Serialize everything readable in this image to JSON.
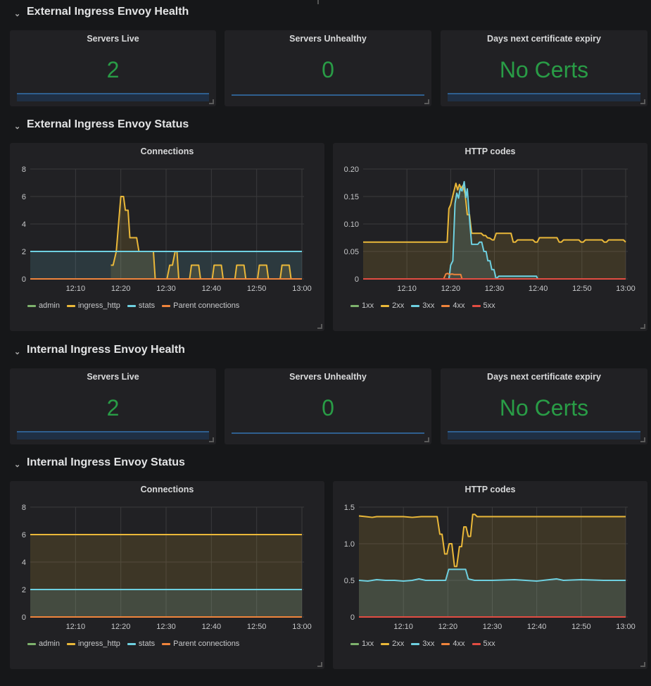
{
  "rows": [
    {
      "title": "External Ingress Envoy Health"
    },
    {
      "title": "External Ingress Envoy Status"
    },
    {
      "title": "Internal Ingress Envoy Health"
    },
    {
      "title": "Internal Ingress Envoy Status"
    }
  ],
  "stat_panels": {
    "external": [
      {
        "title": "Servers Live",
        "value": "2"
      },
      {
        "title": "Servers Unhealthy",
        "value": "0"
      },
      {
        "title": "Days next certificate expiry",
        "value": "No Certs"
      }
    ],
    "internal": [
      {
        "title": "Servers Live",
        "value": "2"
      },
      {
        "title": "Servers Unhealthy",
        "value": "0"
      },
      {
        "title": "Days next certificate expiry",
        "value": "No Certs"
      }
    ]
  },
  "colors": {
    "stat_value": "#299c46",
    "admin": "#7eb26d",
    "ingress_http": "#eab839",
    "stats": "#6ed0e0",
    "parent": "#ef843c",
    "c1xx": "#7eb26d",
    "c2xx": "#eab839",
    "c3xx": "#6ed0e0",
    "c4xx": "#ef843c",
    "c5xx": "#e24d42"
  },
  "chart_data": [
    {
      "id": "ext-connections",
      "type": "line",
      "title": "Connections",
      "xlabel": "",
      "ylabel": "",
      "x_range_minutes": [
        0,
        60
      ],
      "x_ticks": [
        "12:10",
        "12:20",
        "12:30",
        "12:40",
        "12:50",
        "13:00"
      ],
      "x_tick_minutes": [
        10,
        20,
        30,
        40,
        50,
        60
      ],
      "ylim": [
        0,
        8
      ],
      "y_ticks": [
        "0",
        "2",
        "4",
        "6",
        "8"
      ],
      "y_tick_values": [
        0,
        2,
        4,
        6,
        8
      ],
      "grid": true,
      "legend": "bottom-left",
      "series": [
        {
          "name": "admin",
          "color_key": "admin",
          "fill": false,
          "points": []
        },
        {
          "name": "ingress_http",
          "color_key": "ingress_http",
          "fill": true,
          "points": [
            [
              17.8,
              1
            ],
            [
              18.3,
              1
            ],
            [
              19,
              2
            ],
            [
              19.5,
              4
            ],
            [
              20,
              6
            ],
            [
              20.6,
              6
            ],
            [
              21,
              5
            ],
            [
              21.6,
              5
            ],
            [
              22,
              3
            ],
            [
              23.5,
              3
            ],
            [
              24,
              2
            ],
            [
              27.2,
              2
            ],
            [
              27.6,
              0
            ],
            [
              30.2,
              0
            ],
            [
              30.8,
              1
            ],
            [
              31.4,
              1
            ],
            [
              32,
              2
            ],
            [
              32.4,
              2
            ],
            [
              32.8,
              0
            ],
            [
              35.2,
              0
            ],
            [
              35.6,
              1
            ],
            [
              37.2,
              1
            ],
            [
              37.6,
              0
            ],
            [
              40.2,
              0
            ],
            [
              40.6,
              1
            ],
            [
              42.2,
              1
            ],
            [
              42.6,
              0
            ],
            [
              45.2,
              0
            ],
            [
              45.6,
              1
            ],
            [
              47.2,
              1
            ],
            [
              47.6,
              0
            ],
            [
              50.2,
              0
            ],
            [
              50.6,
              1
            ],
            [
              52.2,
              1
            ],
            [
              52.6,
              0
            ],
            [
              55.2,
              0
            ],
            [
              55.6,
              1
            ],
            [
              57.2,
              1
            ],
            [
              57.6,
              0
            ]
          ]
        },
        {
          "name": "stats",
          "color_key": "stats",
          "fill": true,
          "points": [
            [
              0,
              2
            ],
            [
              60,
              2
            ]
          ]
        },
        {
          "name": "Parent connections",
          "color_key": "parent",
          "fill": false,
          "points": [
            [
              0,
              0
            ],
            [
              60,
              0
            ]
          ]
        }
      ]
    },
    {
      "id": "ext-http",
      "type": "line",
      "title": "HTTP codes",
      "xlabel": "",
      "ylabel": "",
      "x_range_minutes": [
        0,
        60
      ],
      "x_ticks": [
        "12:10",
        "12:20",
        "12:30",
        "12:40",
        "12:50",
        "13:00"
      ],
      "x_tick_minutes": [
        10,
        20,
        30,
        40,
        50,
        60
      ],
      "ylim": [
        0,
        0.2
      ],
      "y_ticks": [
        "0",
        "0.05",
        "0.10",
        "0.15",
        "0.20"
      ],
      "y_tick_values": [
        0,
        0.05,
        0.1,
        0.15,
        0.2
      ],
      "grid": true,
      "legend": "bottom-left",
      "series": [
        {
          "name": "1xx",
          "color_key": "c1xx",
          "fill": false,
          "points": []
        },
        {
          "name": "2xx",
          "color_key": "c2xx",
          "fill": true,
          "points": [
            [
              0,
              0.067
            ],
            [
              19.2,
              0.067
            ],
            [
              19.6,
              0.128
            ],
            [
              20,
              0.135
            ],
            [
              20.6,
              0.155
            ],
            [
              21.2,
              0.174
            ],
            [
              21.6,
              0.162
            ],
            [
              22,
              0.172
            ],
            [
              22.4,
              0.165
            ],
            [
              22.8,
              0.17
            ],
            [
              23.3,
              0.155
            ],
            [
              23.8,
              0.117
            ],
            [
              24.3,
              0.117
            ],
            [
              24.8,
              0.083
            ],
            [
              27,
              0.083
            ],
            [
              27.5,
              0.079
            ],
            [
              28,
              0.079
            ],
            [
              28.4,
              0.075
            ],
            [
              29,
              0.074
            ],
            [
              29.5,
              0.071
            ],
            [
              29.9,
              0.071
            ],
            [
              30.4,
              0.083
            ],
            [
              33.8,
              0.083
            ],
            [
              34.3,
              0.067
            ],
            [
              34.8,
              0.067
            ],
            [
              35.3,
              0.071
            ],
            [
              38.8,
              0.071
            ],
            [
              39.3,
              0.067
            ],
            [
              39.8,
              0.067
            ],
            [
              40.3,
              0.075
            ],
            [
              44.3,
              0.075
            ],
            [
              44.8,
              0.067
            ],
            [
              45.3,
              0.067
            ],
            [
              45.8,
              0.071
            ],
            [
              49.3,
              0.071
            ],
            [
              49.8,
              0.067
            ],
            [
              50.3,
              0.067
            ],
            [
              50.8,
              0.071
            ],
            [
              54.6,
              0.071
            ],
            [
              55.1,
              0.067
            ],
            [
              55.6,
              0.067
            ],
            [
              56.1,
              0.071
            ],
            [
              59.5,
              0.071
            ],
            [
              60,
              0.067
            ]
          ]
        },
        {
          "name": "3xx",
          "color_key": "c3xx",
          "fill": true,
          "points": [
            [
              19.6,
              0
            ],
            [
              20,
              0.025
            ],
            [
              20.5,
              0.033
            ],
            [
              21,
              0.137
            ],
            [
              21.4,
              0.156
            ],
            [
              21.8,
              0.147
            ],
            [
              22.2,
              0.165
            ],
            [
              22.6,
              0.16
            ],
            [
              23.1,
              0.177
            ],
            [
              23.5,
              0.148
            ],
            [
              23.8,
              0.164
            ],
            [
              24.4,
              0.1
            ],
            [
              24.8,
              0.063
            ],
            [
              26.2,
              0.063
            ],
            [
              26.6,
              0.067
            ],
            [
              27.1,
              0.067
            ],
            [
              27.6,
              0.05
            ],
            [
              28.1,
              0.05
            ],
            [
              28.5,
              0.033
            ],
            [
              29,
              0.033
            ],
            [
              29.4,
              0.017
            ],
            [
              29.9,
              0.017
            ],
            [
              30.4,
              0
            ],
            [
              31,
              0.005
            ],
            [
              39.6,
              0.005
            ],
            [
              39.9,
              0
            ]
          ]
        },
        {
          "name": "4xx",
          "color_key": "c4xx",
          "fill": false,
          "points": [
            [
              18.4,
              0
            ],
            [
              18.9,
              0.009
            ],
            [
              19.3,
              0.01
            ],
            [
              19.8,
              0.008
            ],
            [
              20.3,
              0.009
            ],
            [
              20.8,
              0.008
            ],
            [
              21.3,
              0.008
            ],
            [
              21.8,
              0.008
            ],
            [
              22.3,
              0.008
            ],
            [
              22.6,
              0
            ]
          ]
        },
        {
          "name": "5xx",
          "color_key": "c5xx",
          "fill": false,
          "points": [
            [
              0,
              0
            ],
            [
              60,
              0
            ]
          ]
        }
      ]
    },
    {
      "id": "int-connections",
      "type": "line",
      "title": "Connections",
      "xlabel": "",
      "ylabel": "",
      "x_range_minutes": [
        0,
        60
      ],
      "x_ticks": [
        "12:10",
        "12:20",
        "12:30",
        "12:40",
        "12:50",
        "13:00"
      ],
      "x_tick_minutes": [
        10,
        20,
        30,
        40,
        50,
        60
      ],
      "ylim": [
        0,
        8
      ],
      "y_ticks": [
        "0",
        "2",
        "4",
        "6",
        "8"
      ],
      "y_tick_values": [
        0,
        2,
        4,
        6,
        8
      ],
      "grid": true,
      "legend": "bottom-left",
      "series": [
        {
          "name": "admin",
          "color_key": "admin",
          "fill": false,
          "points": []
        },
        {
          "name": "ingress_http",
          "color_key": "ingress_http",
          "fill": true,
          "points": [
            [
              0,
              6
            ],
            [
              60,
              6
            ]
          ]
        },
        {
          "name": "stats",
          "color_key": "stats",
          "fill": true,
          "points": [
            [
              0,
              2
            ],
            [
              60,
              2
            ]
          ]
        },
        {
          "name": "Parent connections",
          "color_key": "parent",
          "fill": false,
          "points": [
            [
              0,
              0
            ],
            [
              60,
              0
            ]
          ]
        }
      ]
    },
    {
      "id": "int-http",
      "type": "line",
      "title": "HTTP codes",
      "xlabel": "",
      "ylabel": "",
      "x_range_minutes": [
        0,
        60
      ],
      "x_ticks": [
        "12:10",
        "12:20",
        "12:30",
        "12:40",
        "12:50",
        "13:00"
      ],
      "x_tick_minutes": [
        10,
        20,
        30,
        40,
        50,
        60
      ],
      "ylim": [
        0,
        1.5
      ],
      "y_ticks": [
        "0",
        "0.5",
        "1.0",
        "1.5"
      ],
      "y_tick_values": [
        0,
        0.5,
        1.0,
        1.5
      ],
      "grid": true,
      "legend": "bottom-left",
      "series": [
        {
          "name": "1xx",
          "color_key": "c1xx",
          "fill": false,
          "points": []
        },
        {
          "name": "2xx",
          "color_key": "c2xx",
          "fill": true,
          "points": [
            [
              0,
              1.38
            ],
            [
              1.5,
              1.37
            ],
            [
              3,
              1.36
            ],
            [
              4,
              1.37
            ],
            [
              6,
              1.37
            ],
            [
              8,
              1.37
            ],
            [
              10,
              1.37
            ],
            [
              12,
              1.36
            ],
            [
              14,
              1.37
            ],
            [
              17.6,
              1.37
            ],
            [
              18.2,
              1.13
            ],
            [
              18.7,
              1.13
            ],
            [
              19.3,
              0.86
            ],
            [
              19.8,
              0.86
            ],
            [
              20.3,
              1.0
            ],
            [
              20.9,
              1.0
            ],
            [
              21.5,
              0.69
            ],
            [
              22,
              0.69
            ],
            [
              22.6,
              0.96
            ],
            [
              23.1,
              0.96
            ],
            [
              23.6,
              1.23
            ],
            [
              24.1,
              1.23
            ],
            [
              24.6,
              1.1
            ],
            [
              25.1,
              1.1
            ],
            [
              25.6,
              1.4
            ],
            [
              26.1,
              1.4
            ],
            [
              26.6,
              1.37
            ],
            [
              60,
              1.37
            ]
          ]
        },
        {
          "name": "3xx",
          "color_key": "c3xx",
          "fill": true,
          "points": [
            [
              0,
              0.5
            ],
            [
              2,
              0.49
            ],
            [
              4,
              0.51
            ],
            [
              6,
              0.5
            ],
            [
              8,
              0.5
            ],
            [
              10,
              0.49
            ],
            [
              12,
              0.5
            ],
            [
              13.5,
              0.52
            ],
            [
              15,
              0.5
            ],
            [
              17,
              0.5
            ],
            [
              19.5,
              0.5
            ],
            [
              20.2,
              0.65
            ],
            [
              24,
              0.65
            ],
            [
              24.6,
              0.52
            ],
            [
              26,
              0.5
            ],
            [
              30,
              0.5
            ],
            [
              35,
              0.51
            ],
            [
              40,
              0.49
            ],
            [
              44.5,
              0.52
            ],
            [
              46,
              0.5
            ],
            [
              50,
              0.51
            ],
            [
              55,
              0.5
            ],
            [
              60,
              0.5
            ]
          ]
        },
        {
          "name": "4xx",
          "color_key": "c4xx",
          "fill": false,
          "points": [
            [
              0,
              0
            ],
            [
              60,
              0
            ]
          ]
        },
        {
          "name": "5xx",
          "color_key": "c5xx",
          "fill": false,
          "points": [
            [
              0,
              0
            ],
            [
              60,
              0
            ]
          ]
        }
      ]
    }
  ]
}
